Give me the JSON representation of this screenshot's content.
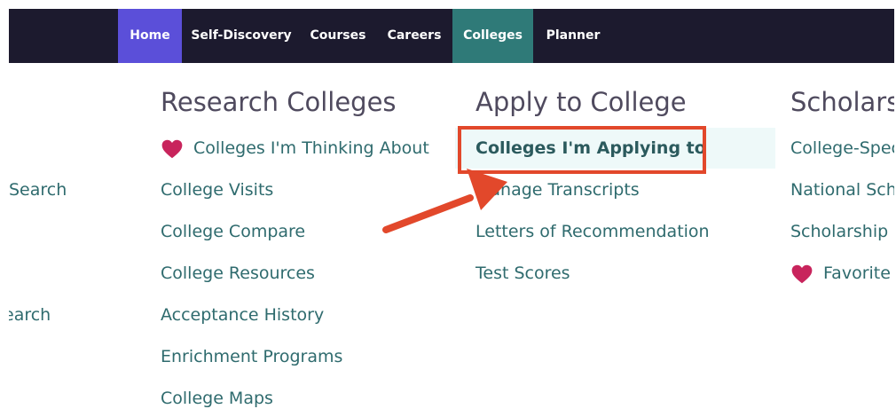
{
  "nav": {
    "home": "Home",
    "self_discovery": "Self-Discovery",
    "courses": "Courses",
    "careers": "Careers",
    "colleges": "Colleges",
    "planner": "Planner"
  },
  "left_partial": {
    "item1": "Search",
    "item2": "earch"
  },
  "research": {
    "title": "Research Colleges",
    "items": [
      "Colleges I'm Thinking About",
      "College Visits",
      "College Compare",
      "College Resources",
      "Acceptance History",
      "Enrichment Programs",
      "College Maps"
    ]
  },
  "apply": {
    "title": "Apply to College",
    "items": [
      "Colleges I'm Applying to",
      "Manage Transcripts",
      "Letters of Recommendation",
      "Test Scores"
    ]
  },
  "scholarships": {
    "title": "Scholarshi",
    "items": [
      "College-Spec",
      "National Scho",
      "Scholarship S",
      "Favorite S"
    ]
  },
  "colors": {
    "nav_bg": "#1c1a2e",
    "home_active": "#5b4fd9",
    "colleges_active": "#2f7a78",
    "link": "#2f6b6e",
    "heart": "#c8245c",
    "callout": "#e2482b"
  },
  "icons": {
    "heart": "heart-icon",
    "arrow": "arrow-annotation"
  }
}
